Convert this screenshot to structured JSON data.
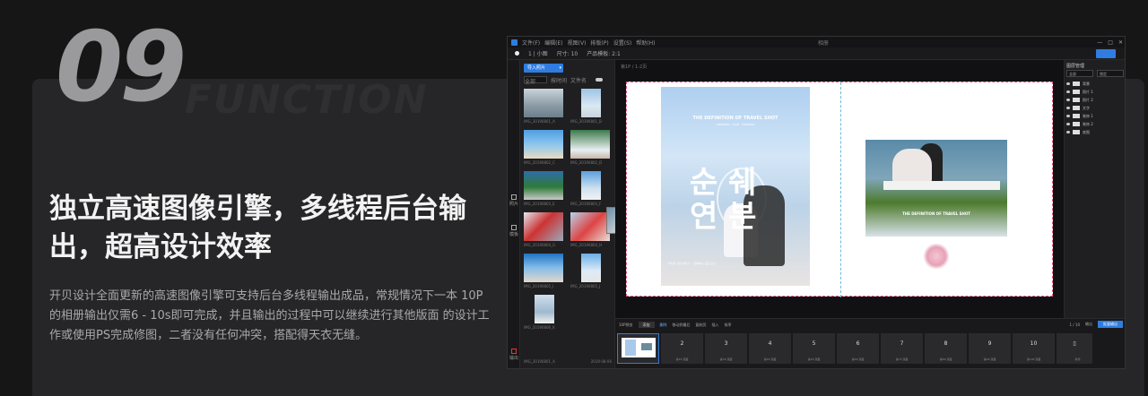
{
  "feature": {
    "number": "09",
    "watermark": "FUNCTION",
    "headline": "独立高速图像引擎，多线程后台输出，超高设计效率",
    "description": "开贝设计全面更新的高速图像引擎可支持后台多线程输出成品，常规情况下一本 10P的相册输出仅需6 - 10s即可完成，并且输出的过程中可以继续进行其他版面 的设计工作或使用PS完成修图，二者没有任何冲突，搭配得天衣无缝。"
  },
  "app": {
    "menu": [
      "文件(F)",
      "编辑(E)",
      "视图(V)",
      "排版(P)",
      "设置(S)",
      "帮助(H)"
    ],
    "window_title": "相册",
    "window_controls": [
      "—",
      "□",
      "✕"
    ],
    "toolbar": [
      "1 | 小图",
      "尺寸: 10",
      "产品模板: 2:1"
    ],
    "rail": [
      "照片",
      "模板",
      "输出"
    ],
    "library": {
      "import_label": "导入照片",
      "filter": [
        "全部",
        "按时间",
        "文件名"
      ],
      "thumbs": [
        {
          "caption": "IMG_20190801_A"
        },
        {
          "caption": "IMG_20190801_B"
        },
        {
          "caption": "IMG_20190802_C"
        },
        {
          "caption": "IMG_20190802_D"
        },
        {
          "caption": "IMG_20190803_E"
        },
        {
          "caption": "IMG_20190803_F"
        },
        {
          "caption": "IMG_20190804_G"
        },
        {
          "caption": "IMG_20190804_H"
        },
        {
          "caption": "IMG_20190805_I"
        },
        {
          "caption": "IMG_20190805_J"
        },
        {
          "caption": "IMG_20190806_K"
        }
      ],
      "footer_left": "IMG_20190801_A",
      "footer_right": "2019-08-06"
    },
    "canvas": {
      "breadcrumb": "第1P / 1-2页",
      "left_photo_title": "THE DEFINITION OF TRAVEL SHOT",
      "left_photo_sub": "WEDDING · LOVE · FOREVER",
      "left_photo_korean": "순 쉐\n연 분",
      "left_photo_fine": "우리의 사랑 이야기 — 함께하는 모든 순간",
      "right_photo_title": "THE DEFINITION OF TRAVEL SHOT"
    },
    "layers": {
      "header": "图层管理",
      "select_a": "全部",
      "select_b": "锁定",
      "items": [
        "背景",
        "照片 1",
        "照片 2",
        "文字",
        "装饰 1",
        "装饰 2",
        "底图"
      ]
    },
    "bottom": {
      "tools": [
        "10P预览",
        "添加",
        "删除",
        "移动到最后",
        "复制页",
        "插入",
        "排序"
      ],
      "zoom": "1 / 10",
      "output_label": "输出",
      "export_label": "批量输出",
      "pages": [
        {
          "num": "",
          "cap": ""
        },
        {
          "num": "2",
          "cap": "第2P·双面"
        },
        {
          "num": "3",
          "cap": "第3P·双面"
        },
        {
          "num": "4",
          "cap": "第4P·双面"
        },
        {
          "num": "5",
          "cap": "第5P·双面"
        },
        {
          "num": "6",
          "cap": "第6P·双面"
        },
        {
          "num": "7",
          "cap": "第7P·双面"
        },
        {
          "num": "8",
          "cap": "第8P·双面"
        },
        {
          "num": "9",
          "cap": "第9P·双面"
        },
        {
          "num": "10",
          "cap": "第10P·双面"
        }
      ],
      "add_page_cap": "新增"
    }
  }
}
